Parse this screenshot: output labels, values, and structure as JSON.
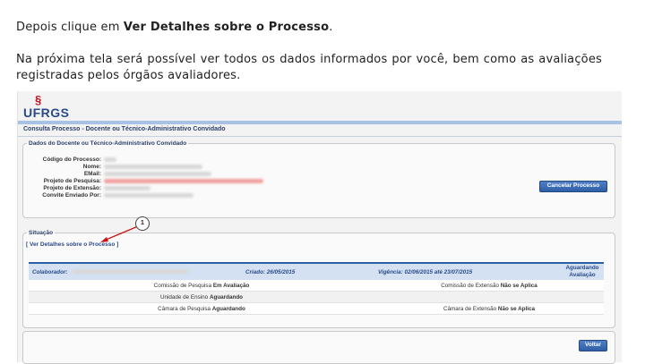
{
  "intro": {
    "p1_pre": "Depois clique em ",
    "p1_bold": "Ver Detalhes sobre o Processo",
    "p1_post": ".",
    "p2": "Na próxima tela será possível ver todos os dados informados por você, bem como as avaliações registradas pelos órgãos avaliadores."
  },
  "app": {
    "logo": "UFRGS",
    "page_title": "Consulta Processo - Docente ou Técnico-Administrativo Convidado",
    "colors": {
      "brand_blue": "#2b4a8a",
      "bar_blue": "#a7c2e4",
      "logo_red": "#b5121b"
    }
  },
  "dados": {
    "legend": "Dados do Docente ou Técnico-Administrativo Convidado",
    "labels": [
      "Código do Processo:",
      "Nome:",
      "EMail:",
      "Projeto de Pesquisa:",
      "Projeto de Extensão:",
      "Convite Enviado Por:"
    ],
    "cancel_button": "Cancelar Processo"
  },
  "situacao": {
    "legend": "Situação",
    "details_link": "[ Ver Detalhes sobre o Processo ]",
    "callout_number": "1",
    "header": {
      "colaborador_label": "Colaborador:",
      "criado_label": "Criado:",
      "criado_value": "26/05/2015",
      "vigencia_label": "Vigência:",
      "vigencia_value": "02/06/2015 até 23/07/2015",
      "status_line1": "Aguardando",
      "status_line2": "Avaliação"
    },
    "rows": [
      {
        "left_label": "Comissão de Pesquisa",
        "left_status": "Em Avaliação",
        "right_label": "Comissão de Extensão",
        "right_status": "Não se Aplica"
      },
      {
        "left_label": "Unidade de Ensino",
        "left_status": "Aguardando",
        "right_label": "",
        "right_status": ""
      },
      {
        "left_label": "Câmara de Pesquisa",
        "left_status": "Aguardando",
        "right_label": "Câmara de Extensão",
        "right_status": "Não se Aplica"
      }
    ]
  },
  "footer": {
    "voltar_button": "Voltar"
  }
}
